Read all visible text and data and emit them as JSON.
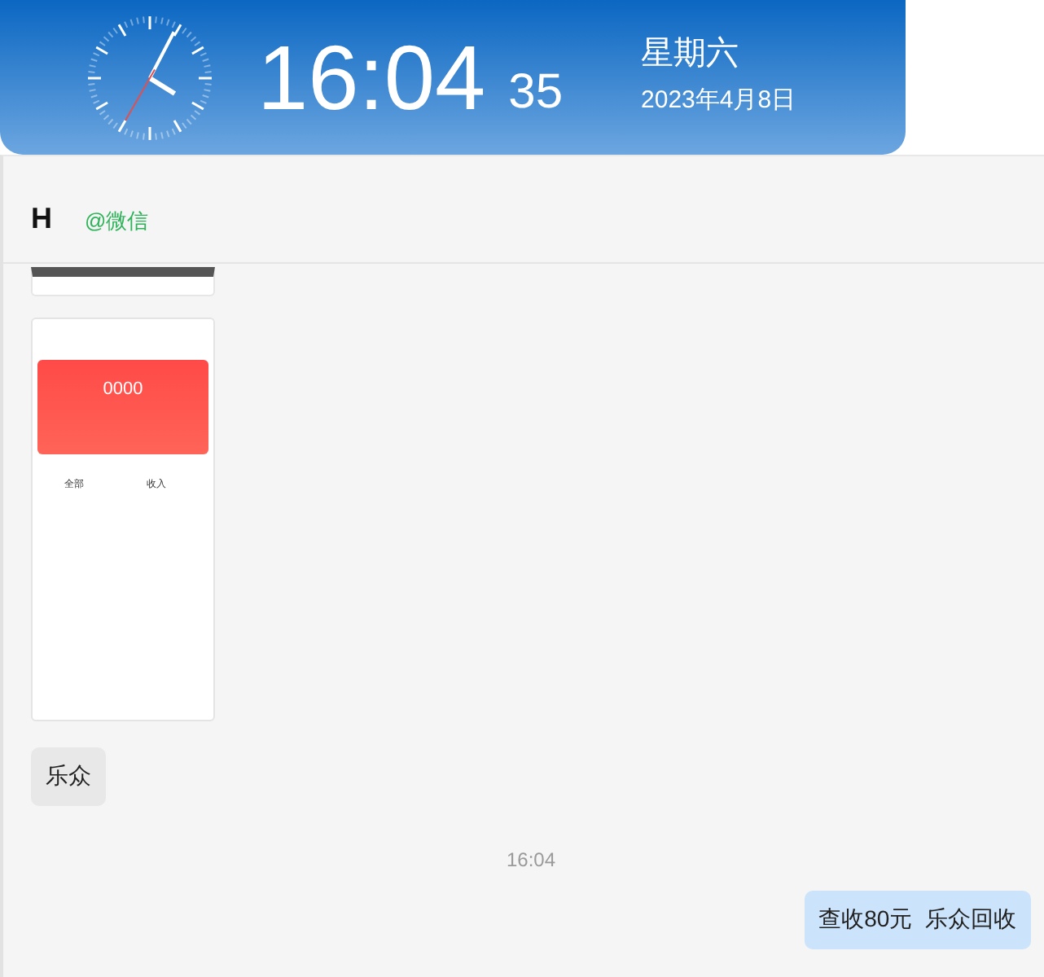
{
  "clock_banner": {
    "time": "16:04",
    "seconds": "35",
    "weekday": "星期六",
    "date": "2023年4月8日"
  },
  "chat": {
    "contact_name": "H",
    "source": "@微信",
    "messages": [
      {
        "kind": "image_strip"
      },
      {
        "kind": "phone_screenshot",
        "balance": "0000",
        "tabs": [
          "全部",
          "收入"
        ]
      },
      {
        "kind": "text",
        "outgoing": false,
        "text": "乐众"
      },
      {
        "kind": "time",
        "text": "16:04"
      },
      {
        "kind": "text",
        "outgoing": true,
        "text": "查收80元  乐众回收"
      }
    ]
  }
}
